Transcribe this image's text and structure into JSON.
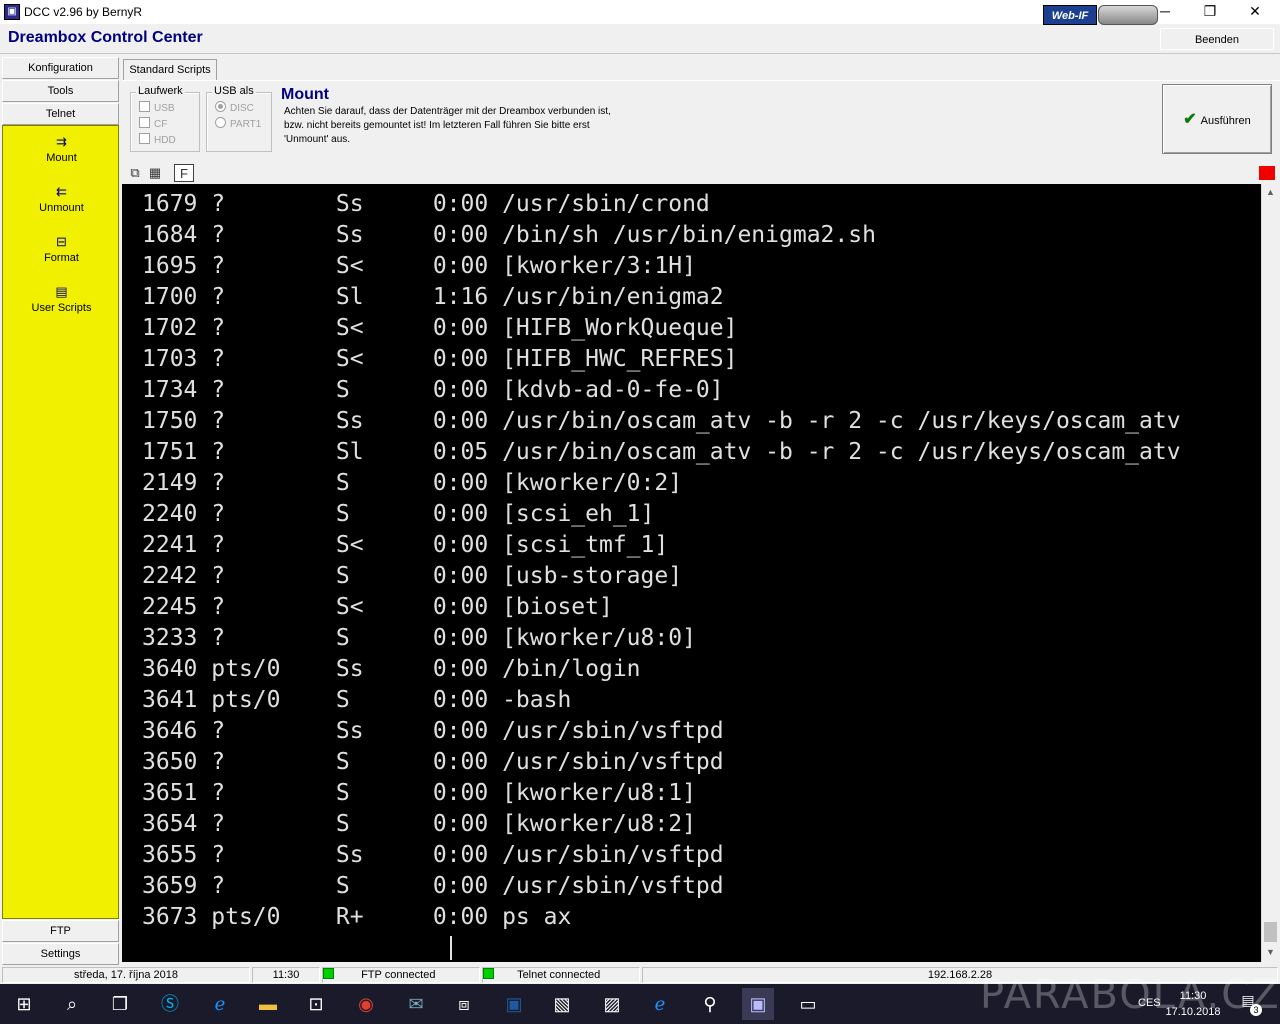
{
  "window": {
    "title": "DCC v2.96 by BernyR",
    "minimize": "─",
    "maximize": "❐",
    "close": "✕"
  },
  "header": {
    "app_name": "Dreambox Control Center",
    "webif_label": "Web-IF",
    "beenden_label": "Beenden"
  },
  "sidebar": {
    "top_buttons": [
      "Konfiguration",
      "Tools",
      "Telnet"
    ],
    "items": [
      {
        "label": "Mount",
        "icon": "mount-icon"
      },
      {
        "label": "Unmount",
        "icon": "unmount-icon"
      },
      {
        "label": "Format",
        "icon": "format-icon"
      },
      {
        "label": "User Scripts",
        "icon": "user-scripts-icon"
      }
    ],
    "bottom_buttons": [
      "FTP",
      "Settings"
    ]
  },
  "scripts": {
    "tab_label": "Standard Scripts",
    "laufwerk_label": "Laufwerk",
    "laufwerk_options": [
      "USB",
      "CF",
      "HDD"
    ],
    "usb_als_label": "USB als",
    "usb_als_options": [
      "DISC",
      "PART1"
    ],
    "usb_als_selected": "DISC",
    "mount_title": "Mount",
    "mount_desc_1": "Achten Sie darauf, dass der Datenträger mit der Dreambox verbunden ist,",
    "mount_desc_2": "bzw. nicht bereits gemountet ist! Im letzteren Fall führen Sie bitte erst",
    "mount_desc_3": "'Unmount' aus.",
    "run_label": "Ausführen"
  },
  "terminal": {
    "lines": [
      {
        "pid": "1679",
        "tty": "?",
        "stat": "Ss",
        "time": "0:00",
        "cmd": "/usr/sbin/crond"
      },
      {
        "pid": "1684",
        "tty": "?",
        "stat": "Ss",
        "time": "0:00",
        "cmd": "/bin/sh /usr/bin/enigma2.sh"
      },
      {
        "pid": "1695",
        "tty": "?",
        "stat": "S<",
        "time": "0:00",
        "cmd": "[kworker/3:1H]"
      },
      {
        "pid": "1700",
        "tty": "?",
        "stat": "Sl",
        "time": "1:16",
        "cmd": "/usr/bin/enigma2"
      },
      {
        "pid": "1702",
        "tty": "?",
        "stat": "S<",
        "time": "0:00",
        "cmd": "[HIFB_WorkQueque]"
      },
      {
        "pid": "1703",
        "tty": "?",
        "stat": "S<",
        "time": "0:00",
        "cmd": "[HIFB_HWC_REFRES]"
      },
      {
        "pid": "1734",
        "tty": "?",
        "stat": "S",
        "time": "0:00",
        "cmd": "[kdvb-ad-0-fe-0]"
      },
      {
        "pid": "1750",
        "tty": "?",
        "stat": "Ss",
        "time": "0:00",
        "cmd": "/usr/bin/oscam_atv -b -r 2 -c /usr/keys/oscam_atv"
      },
      {
        "pid": "1751",
        "tty": "?",
        "stat": "Sl",
        "time": "0:05",
        "cmd": "/usr/bin/oscam_atv -b -r 2 -c /usr/keys/oscam_atv"
      },
      {
        "pid": "2149",
        "tty": "?",
        "stat": "S",
        "time": "0:00",
        "cmd": "[kworker/0:2]"
      },
      {
        "pid": "2240",
        "tty": "?",
        "stat": "S",
        "time": "0:00",
        "cmd": "[scsi_eh_1]"
      },
      {
        "pid": "2241",
        "tty": "?",
        "stat": "S<",
        "time": "0:00",
        "cmd": "[scsi_tmf_1]"
      },
      {
        "pid": "2242",
        "tty": "?",
        "stat": "S",
        "time": "0:00",
        "cmd": "[usb-storage]"
      },
      {
        "pid": "2245",
        "tty": "?",
        "stat": "S<",
        "time": "0:00",
        "cmd": "[bioset]"
      },
      {
        "pid": "3233",
        "tty": "?",
        "stat": "S",
        "time": "0:00",
        "cmd": "[kworker/u8:0]"
      },
      {
        "pid": "3640",
        "tty": "pts/0",
        "stat": "Ss",
        "time": "0:00",
        "cmd": "/bin/login"
      },
      {
        "pid": "3641",
        "tty": "pts/0",
        "stat": "S",
        "time": "0:00",
        "cmd": "-bash"
      },
      {
        "pid": "3646",
        "tty": "?",
        "stat": "Ss",
        "time": "0:00",
        "cmd": "/usr/sbin/vsftpd"
      },
      {
        "pid": "3650",
        "tty": "?",
        "stat": "S",
        "time": "0:00",
        "cmd": "/usr/sbin/vsftpd"
      },
      {
        "pid": "3651",
        "tty": "?",
        "stat": "S",
        "time": "0:00",
        "cmd": "[kworker/u8:1]"
      },
      {
        "pid": "3654",
        "tty": "?",
        "stat": "S",
        "time": "0:00",
        "cmd": "[kworker/u8:2]"
      },
      {
        "pid": "3655",
        "tty": "?",
        "stat": "Ss",
        "time": "0:00",
        "cmd": "/usr/sbin/vsftpd"
      },
      {
        "pid": "3659",
        "tty": "?",
        "stat": "S",
        "time": "0:00",
        "cmd": "/usr/sbin/vsftpd"
      },
      {
        "pid": "3673",
        "tty": "pts/0",
        "stat": "R+",
        "time": "0:00",
        "cmd": "ps ax"
      }
    ]
  },
  "status": {
    "date": "středa, 17. října 2018",
    "time": "11:30",
    "ftp": "FTP connected",
    "telnet": "Telnet connected",
    "ip": "192.168.2.28"
  },
  "taskbar": {
    "watermark": "PARABOLA.CZ",
    "lang": "CES",
    "clock_time": "11:30",
    "clock_date": "17.10.2018",
    "notif_count": "3"
  },
  "colors": {
    "sidebar_bg": "#f0f000",
    "title_blue": "#000080",
    "terminal_bg": "#000000",
    "terminal_fg": "#e0e0e0",
    "status_led": "#00d000",
    "indicator_red": "#f00000"
  }
}
